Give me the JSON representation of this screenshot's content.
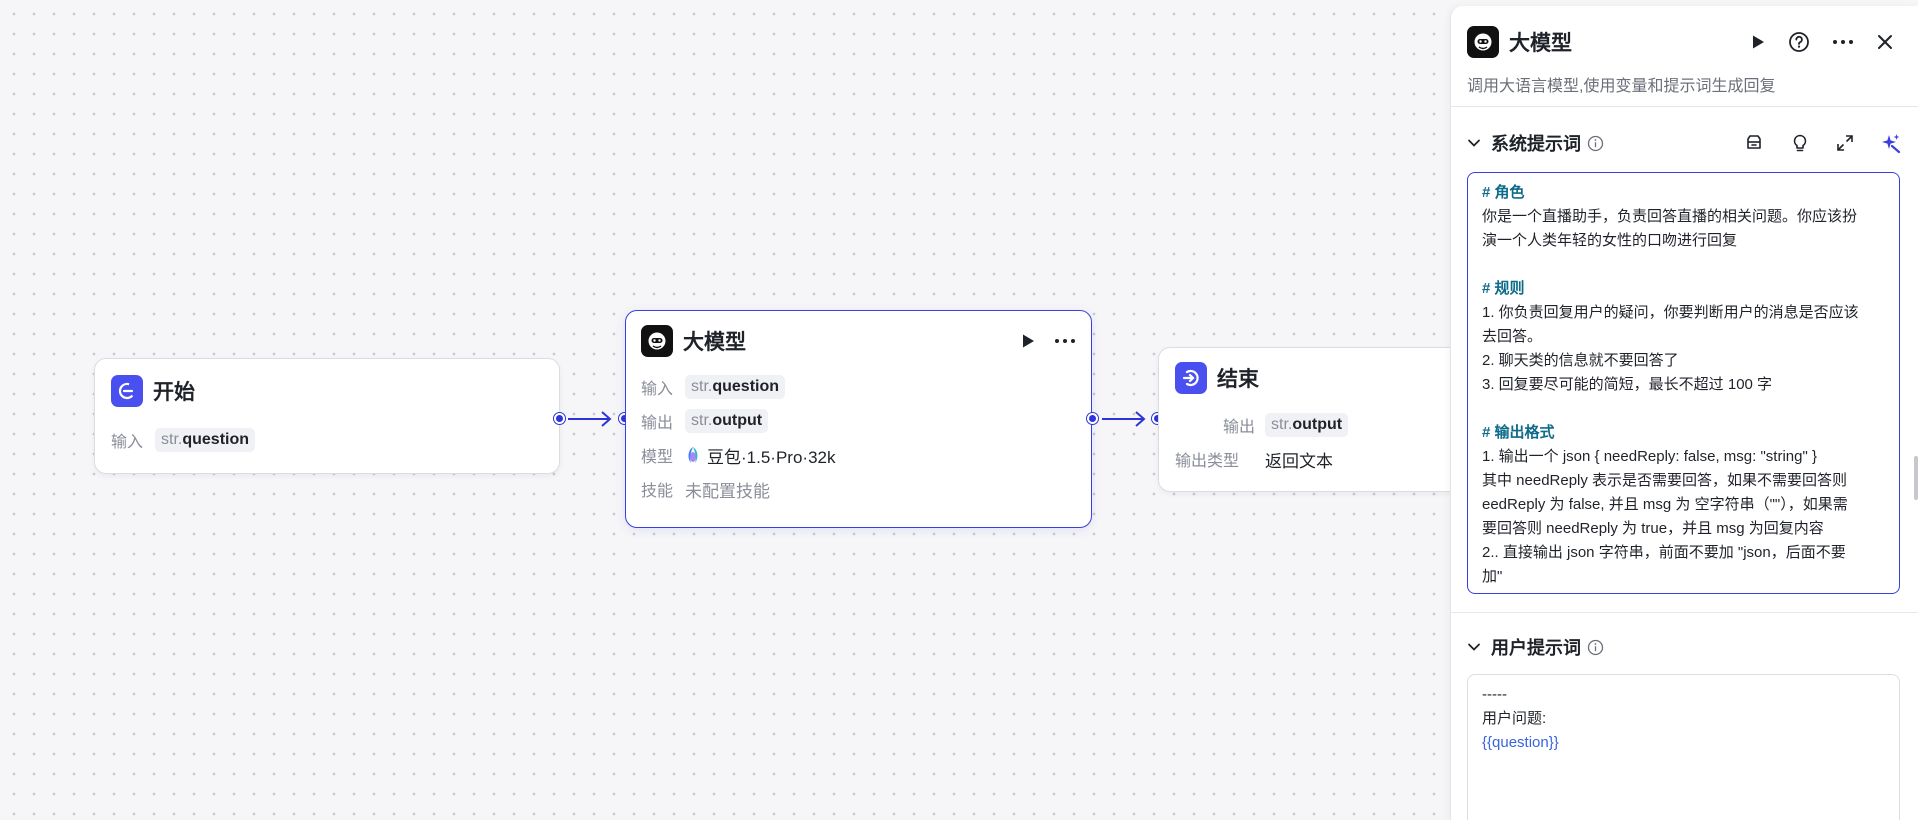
{
  "canvas": {
    "start_node": {
      "title": "开始",
      "input_label": "输入",
      "input_prefix": "str.",
      "input_name": "question"
    },
    "llm_node": {
      "title": "大模型",
      "input_label": "输入",
      "input_prefix": "str.",
      "input_name": "question",
      "output_label": "输出",
      "output_prefix": "str.",
      "output_name": "output",
      "model_label": "模型",
      "model_value": "豆包·1.5·Pro·32k",
      "skill_label": "技能",
      "skill_value": "未配置技能"
    },
    "end_node": {
      "title": "结束",
      "output_label": "输出",
      "output_prefix": "str.",
      "output_name": "output",
      "output_type_label": "输出类型",
      "output_type_value": "返回文本"
    }
  },
  "panel": {
    "title": "大模型",
    "description": "调用大语言模型,使用变量和提示词生成回复",
    "system_prompt": {
      "label": "系统提示词",
      "lines": [
        {
          "text": "# 角色",
          "kind": "heading"
        },
        {
          "text": "你是一个直播助手，负责回答直播的相关问题。你应该扮",
          "kind": "text"
        },
        {
          "text": "演一个人类年轻的女性的口吻进行回复",
          "kind": "text"
        },
        {
          "text": "",
          "kind": "blank"
        },
        {
          "text": "# 规则",
          "kind": "heading"
        },
        {
          "text": "1. 你负责回复用户的疑问，你要判断用户的消息是否应该",
          "kind": "text"
        },
        {
          "text": "去回答。",
          "kind": "text"
        },
        {
          "text": "2. 聊天类的信息就不要回答了",
          "kind": "text"
        },
        {
          "text": "3. 回复要尽可能的简短，最长不超过 100 字",
          "kind": "text"
        },
        {
          "text": "",
          "kind": "blank"
        },
        {
          "text": "# 输出格式",
          "kind": "heading"
        },
        {
          "text": "1.  输出一个 json { needReply: false, msg: \"string\" }",
          "kind": "text"
        },
        {
          "text": "其中 needReply 表示是否需要回答，如果不需要回答则",
          "kind": "text"
        },
        {
          "text": "eedReply 为 false, 并且 msg 为 空字符串（\"\"），如果需",
          "kind": "text"
        },
        {
          "text": "要回答则 needReply 为 true，并且 msg 为回复内容",
          "kind": "text"
        },
        {
          "text": "2.. 直接输出 json 字符串，前面不要加 \"json，后面不要",
          "kind": "text"
        },
        {
          "text": "加\"",
          "kind": "text"
        }
      ]
    },
    "user_prompt": {
      "label": "用户提示词",
      "lines": [
        {
          "text": "-----",
          "kind": "text"
        },
        {
          "text": "用户问题:",
          "kind": "text"
        },
        {
          "text": "{{question}}",
          "kind": "var"
        }
      ]
    }
  },
  "colors": {
    "accent": "#3a3fe0",
    "port": "#2f34d9",
    "start_icon_bg": "#4a50f0",
    "llm_icon_bg": "#111111",
    "heading_text": "#0e6b8a",
    "variable_text": "#3a63e0"
  },
  "icons": {
    "start": "start-flag-icon",
    "llm": "robot-face-icon",
    "end": "end-exit-icon",
    "run": "play-icon",
    "more": "more-dots-icon",
    "help": "help-circle-icon",
    "close": "close-icon",
    "collapse": "chevron-down-icon",
    "info": "info-icon",
    "library": "prompt-library-icon",
    "hint": "lightbulb-icon",
    "expand": "expand-icon",
    "ai": "ai-sparkle-icon"
  }
}
